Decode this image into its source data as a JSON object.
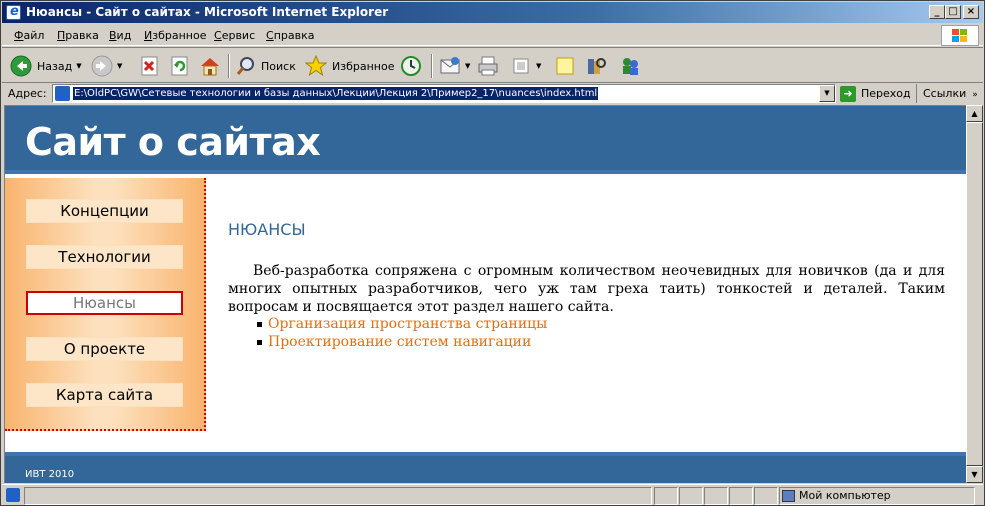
{
  "window": {
    "title": "Нюансы - Сайт о сайтах - Microsoft Internet Explorer",
    "controls": [
      "_",
      "□",
      "×"
    ]
  },
  "menu": {
    "items": [
      "Файл",
      "Правка",
      "Вид",
      "Избранное",
      "Сервис",
      "Справка"
    ],
    "underline": [
      "Ф",
      "П",
      "В",
      "И",
      "С",
      "С"
    ]
  },
  "toolbar": {
    "back_label": "Назад",
    "search_label": "Поиск",
    "favorites_label": "Избранное"
  },
  "address": {
    "label": "Адрес:",
    "url": "E:\\OldPC\\GW\\Сетевые технологии и базы данных\\Лекции\\Лекция 2\\Пример2_17\\nuances\\index.html",
    "go_label": "Переход",
    "links_label": "Ссылки"
  },
  "site": {
    "title": "Сайт о сайтах",
    "nav": [
      "Концепции",
      "Технологии",
      "Нюансы",
      "О проекте",
      "Карта сайта"
    ],
    "active_nav": "Нюансы",
    "section_title": "НЮАНСЫ",
    "paragraph": "Веб-разработка сопряжена с огромным количеством неочевидных для новичков (да и для многих опытных разработчиков, чего уж там греха таить) тонкостей и деталей. Таким вопросам и посвящается этот раздел нашего сайта.",
    "links": [
      "Организация пространства страницы",
      "Проектирование систем навигации"
    ],
    "footer": "ИВТ 2010"
  },
  "status": {
    "zone": "Мой компьютер"
  },
  "colors": {
    "header_bg": "#336699",
    "section_title": "#336699",
    "link": "#e07010",
    "sidebar_border": "#cc0000",
    "sidebar_bg": "#f9b46e"
  }
}
